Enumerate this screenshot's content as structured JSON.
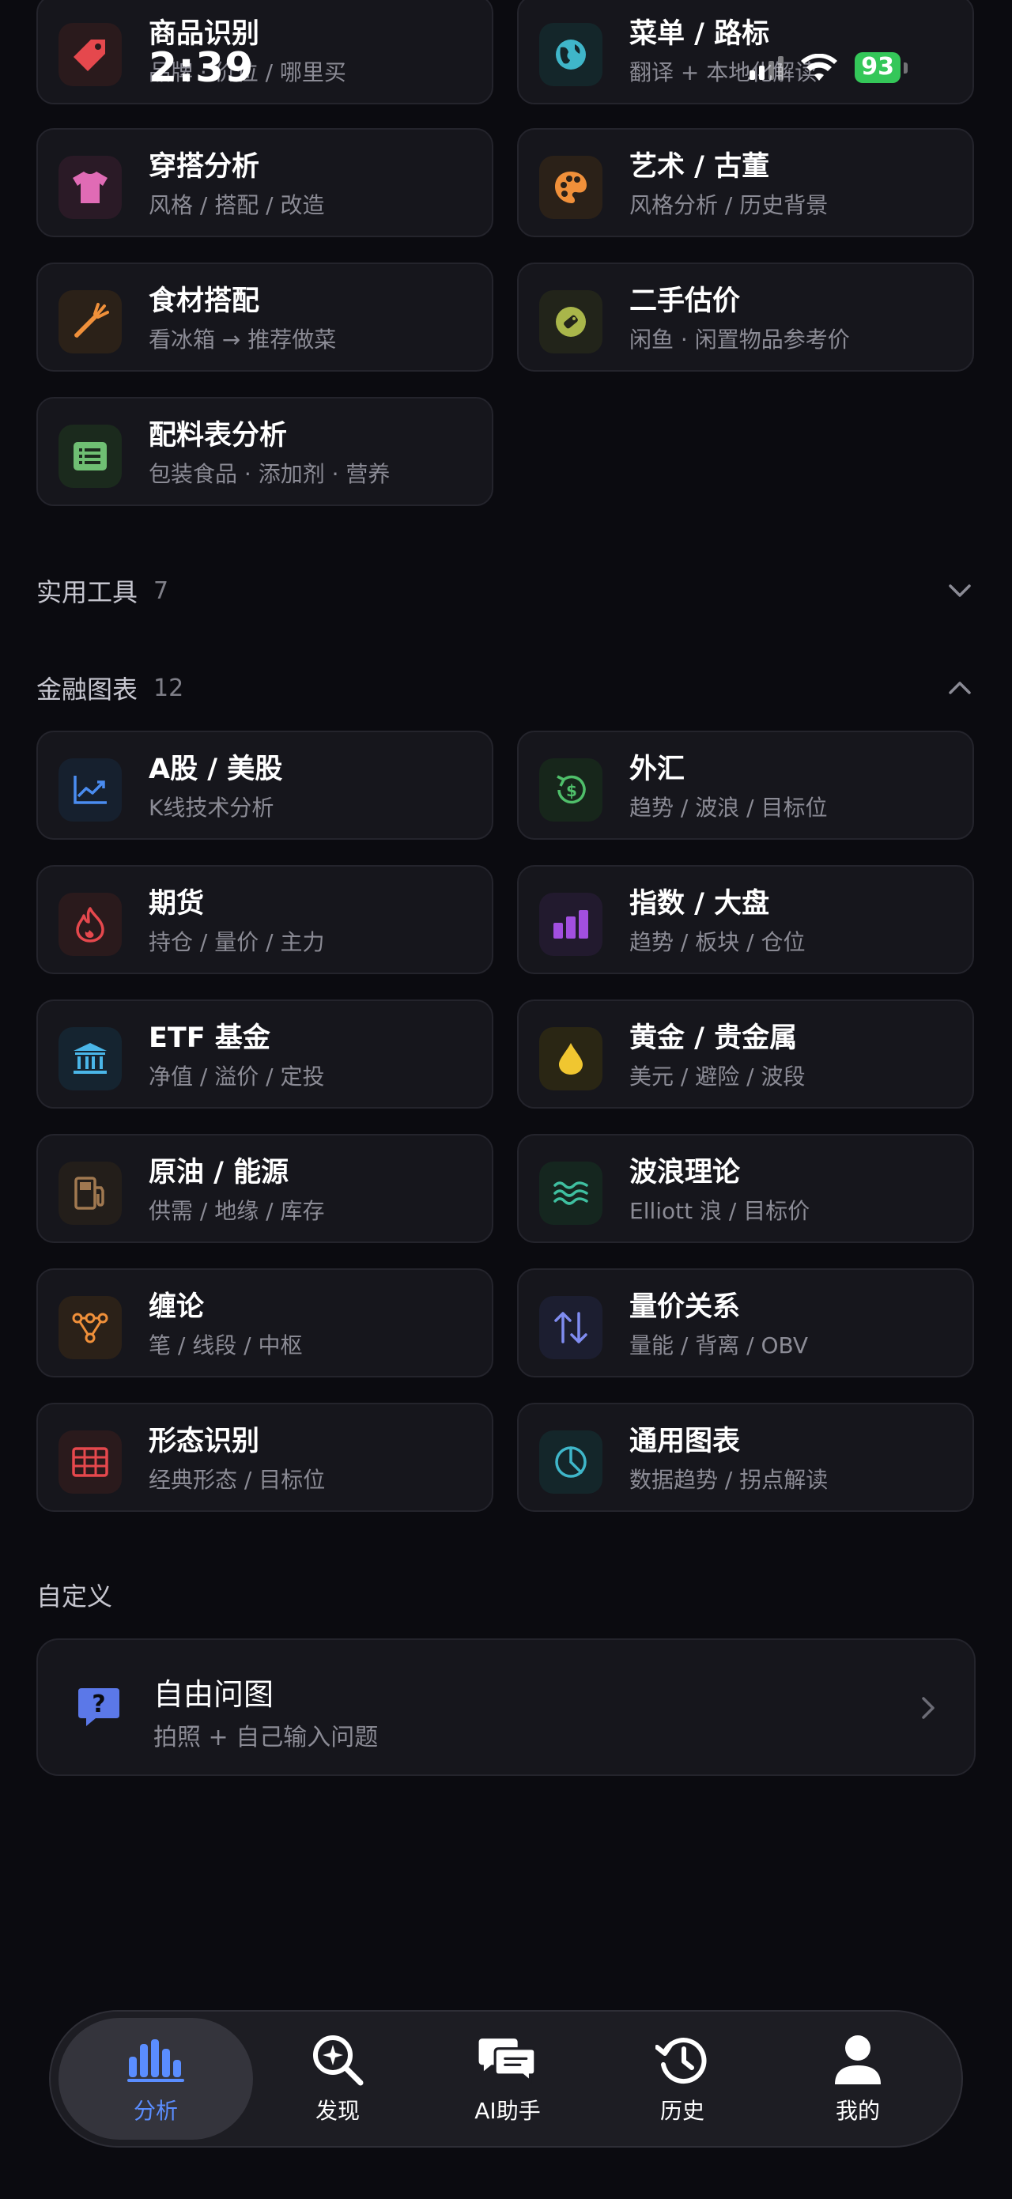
{
  "status_bar": {
    "time": "2:39",
    "battery": "93"
  },
  "top_cards": [
    {
      "title": "商品识别",
      "subtitle": "品牌 · 价位 / 哪里买",
      "icon": "tag-icon",
      "color": "#e5484d",
      "bg": "#2a1a1c"
    },
    {
      "title": "菜单 / 路标",
      "subtitle": "翻译 + 本地化解读",
      "icon": "globe-icon",
      "color": "#3fb6c9",
      "bg": "#14262a"
    },
    {
      "title": "穿搭分析",
      "subtitle": "风格 / 搭配 / 改造",
      "icon": "tshirt-icon",
      "color": "#e06bb5",
      "bg": "#2a1a26"
    },
    {
      "title": "艺术 / 古董",
      "subtitle": "风格分析 / 历史背景",
      "icon": "palette-icon",
      "color": "#f0903a",
      "bg": "#2b2118"
    },
    {
      "title": "食材搭配",
      "subtitle": "看冰箱 → 推荐做菜",
      "icon": "carrot-icon",
      "color": "#f0903a",
      "bg": "#2b2118"
    },
    {
      "title": "二手估价",
      "subtitle": "闲鱼 · 闲置物品参考价",
      "icon": "price-tag-icon",
      "color": "#a9b64a",
      "bg": "#22241a"
    },
    {
      "title": "配料表分析",
      "subtitle": "包装食品 · 添加剂 · 营养",
      "icon": "list-icon",
      "color": "#6fbf73",
      "bg": "#1b2a1d"
    }
  ],
  "sections": {
    "tools": {
      "title": "实用工具",
      "count": "7"
    },
    "finance": {
      "title": "金融图表",
      "count": "12"
    },
    "custom": {
      "title": "自定义"
    }
  },
  "finance_cards": [
    {
      "title": "A股 / 美股",
      "subtitle": "K线技术分析",
      "icon": "trend-chart-icon",
      "color": "#4a8cf0",
      "bg": "#16202e"
    },
    {
      "title": "外汇",
      "subtitle": "趋势 / 波浪 / 目标位",
      "icon": "currency-exchange-icon",
      "color": "#4fbf6a",
      "bg": "#17261b"
    },
    {
      "title": "期货",
      "subtitle": "持仓 / 量价 / 主力",
      "icon": "flame-icon",
      "color": "#e5484d",
      "bg": "#2a1a1c"
    },
    {
      "title": "指数 / 大盘",
      "subtitle": "趋势 / 板块 / 仓位",
      "icon": "bar-chart-icon",
      "color": "#a24fe0",
      "bg": "#221a2e"
    },
    {
      "title": "ETF 基金",
      "subtitle": "净值 / 溢价 / 定投",
      "icon": "bank-icon",
      "color": "#4ab6e8",
      "bg": "#152430"
    },
    {
      "title": "黄金 / 贵金属",
      "subtitle": "美元 / 避险 / 波段",
      "icon": "drop-icon",
      "color": "#f0c630",
      "bg": "#2a2614"
    },
    {
      "title": "原油 / 能源",
      "subtitle": "供需 / 地缘 / 库存",
      "icon": "fuel-pump-icon",
      "color": "#a07850",
      "bg": "#231e1a"
    },
    {
      "title": "波浪理论",
      "subtitle": "Elliott 浪 / 目标价",
      "icon": "waves-icon",
      "color": "#3fbfa0",
      "bg": "#15261f"
    },
    {
      "title": "缠论",
      "subtitle": "笔 / 线段 / 中枢",
      "icon": "nodes-icon",
      "color": "#f0903a",
      "bg": "#2b2118"
    },
    {
      "title": "量价关系",
      "subtitle": "量能 / 背离 / OBV",
      "icon": "up-down-arrows-icon",
      "color": "#7f8cf0",
      "bg": "#1c1e30"
    },
    {
      "title": "形态识别",
      "subtitle": "经典形态 / 目标位",
      "icon": "grid-icon",
      "color": "#e5484d",
      "bg": "#2a1a1c"
    },
    {
      "title": "通用图表",
      "subtitle": "数据趋势 / 拐点解读",
      "icon": "pie-chart-icon",
      "color": "#3fb6c9",
      "bg": "#14262a"
    }
  ],
  "custom_card": {
    "title": "自由问图",
    "subtitle": "拍照 + 自己输入问题",
    "icon": "question-chat-icon",
    "color": "#5b78e8"
  },
  "bottom_nav": [
    {
      "label": "分析",
      "icon": "analysis-bars-icon",
      "active": true
    },
    {
      "label": "发现",
      "icon": "discover-search-icon",
      "active": false
    },
    {
      "label": "AI助手",
      "icon": "chat-bubbles-icon",
      "active": false
    },
    {
      "label": "历史",
      "icon": "history-clock-icon",
      "active": false
    },
    {
      "label": "我的",
      "icon": "person-icon",
      "active": false
    }
  ]
}
